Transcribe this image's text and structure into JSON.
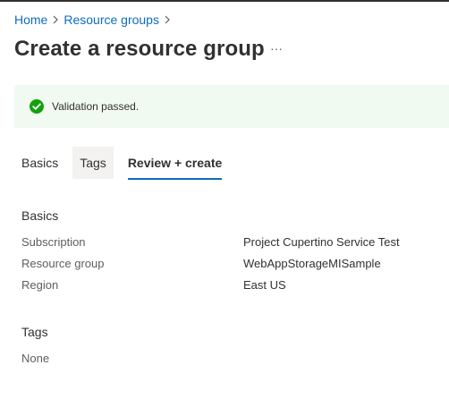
{
  "breadcrumb": {
    "items": [
      "Home",
      "Resource groups"
    ]
  },
  "header": {
    "title": "Create a resource group",
    "more_label": "···"
  },
  "banner": {
    "message": "Validation passed.",
    "color": "#13a10e"
  },
  "tabs": [
    {
      "label": "Basics"
    },
    {
      "label": "Tags"
    },
    {
      "label": "Review + create"
    }
  ],
  "basics": {
    "heading": "Basics",
    "rows": [
      {
        "label": "Subscription",
        "value": "Project Cupertino Service Test"
      },
      {
        "label": "Resource group",
        "value": "WebAppStorageMISample"
      },
      {
        "label": "Region",
        "value": "East US"
      }
    ]
  },
  "tags": {
    "heading": "Tags",
    "value": "None"
  },
  "colors": {
    "accent": "#0f6cbd",
    "banner_bg": "#f1faf1"
  }
}
